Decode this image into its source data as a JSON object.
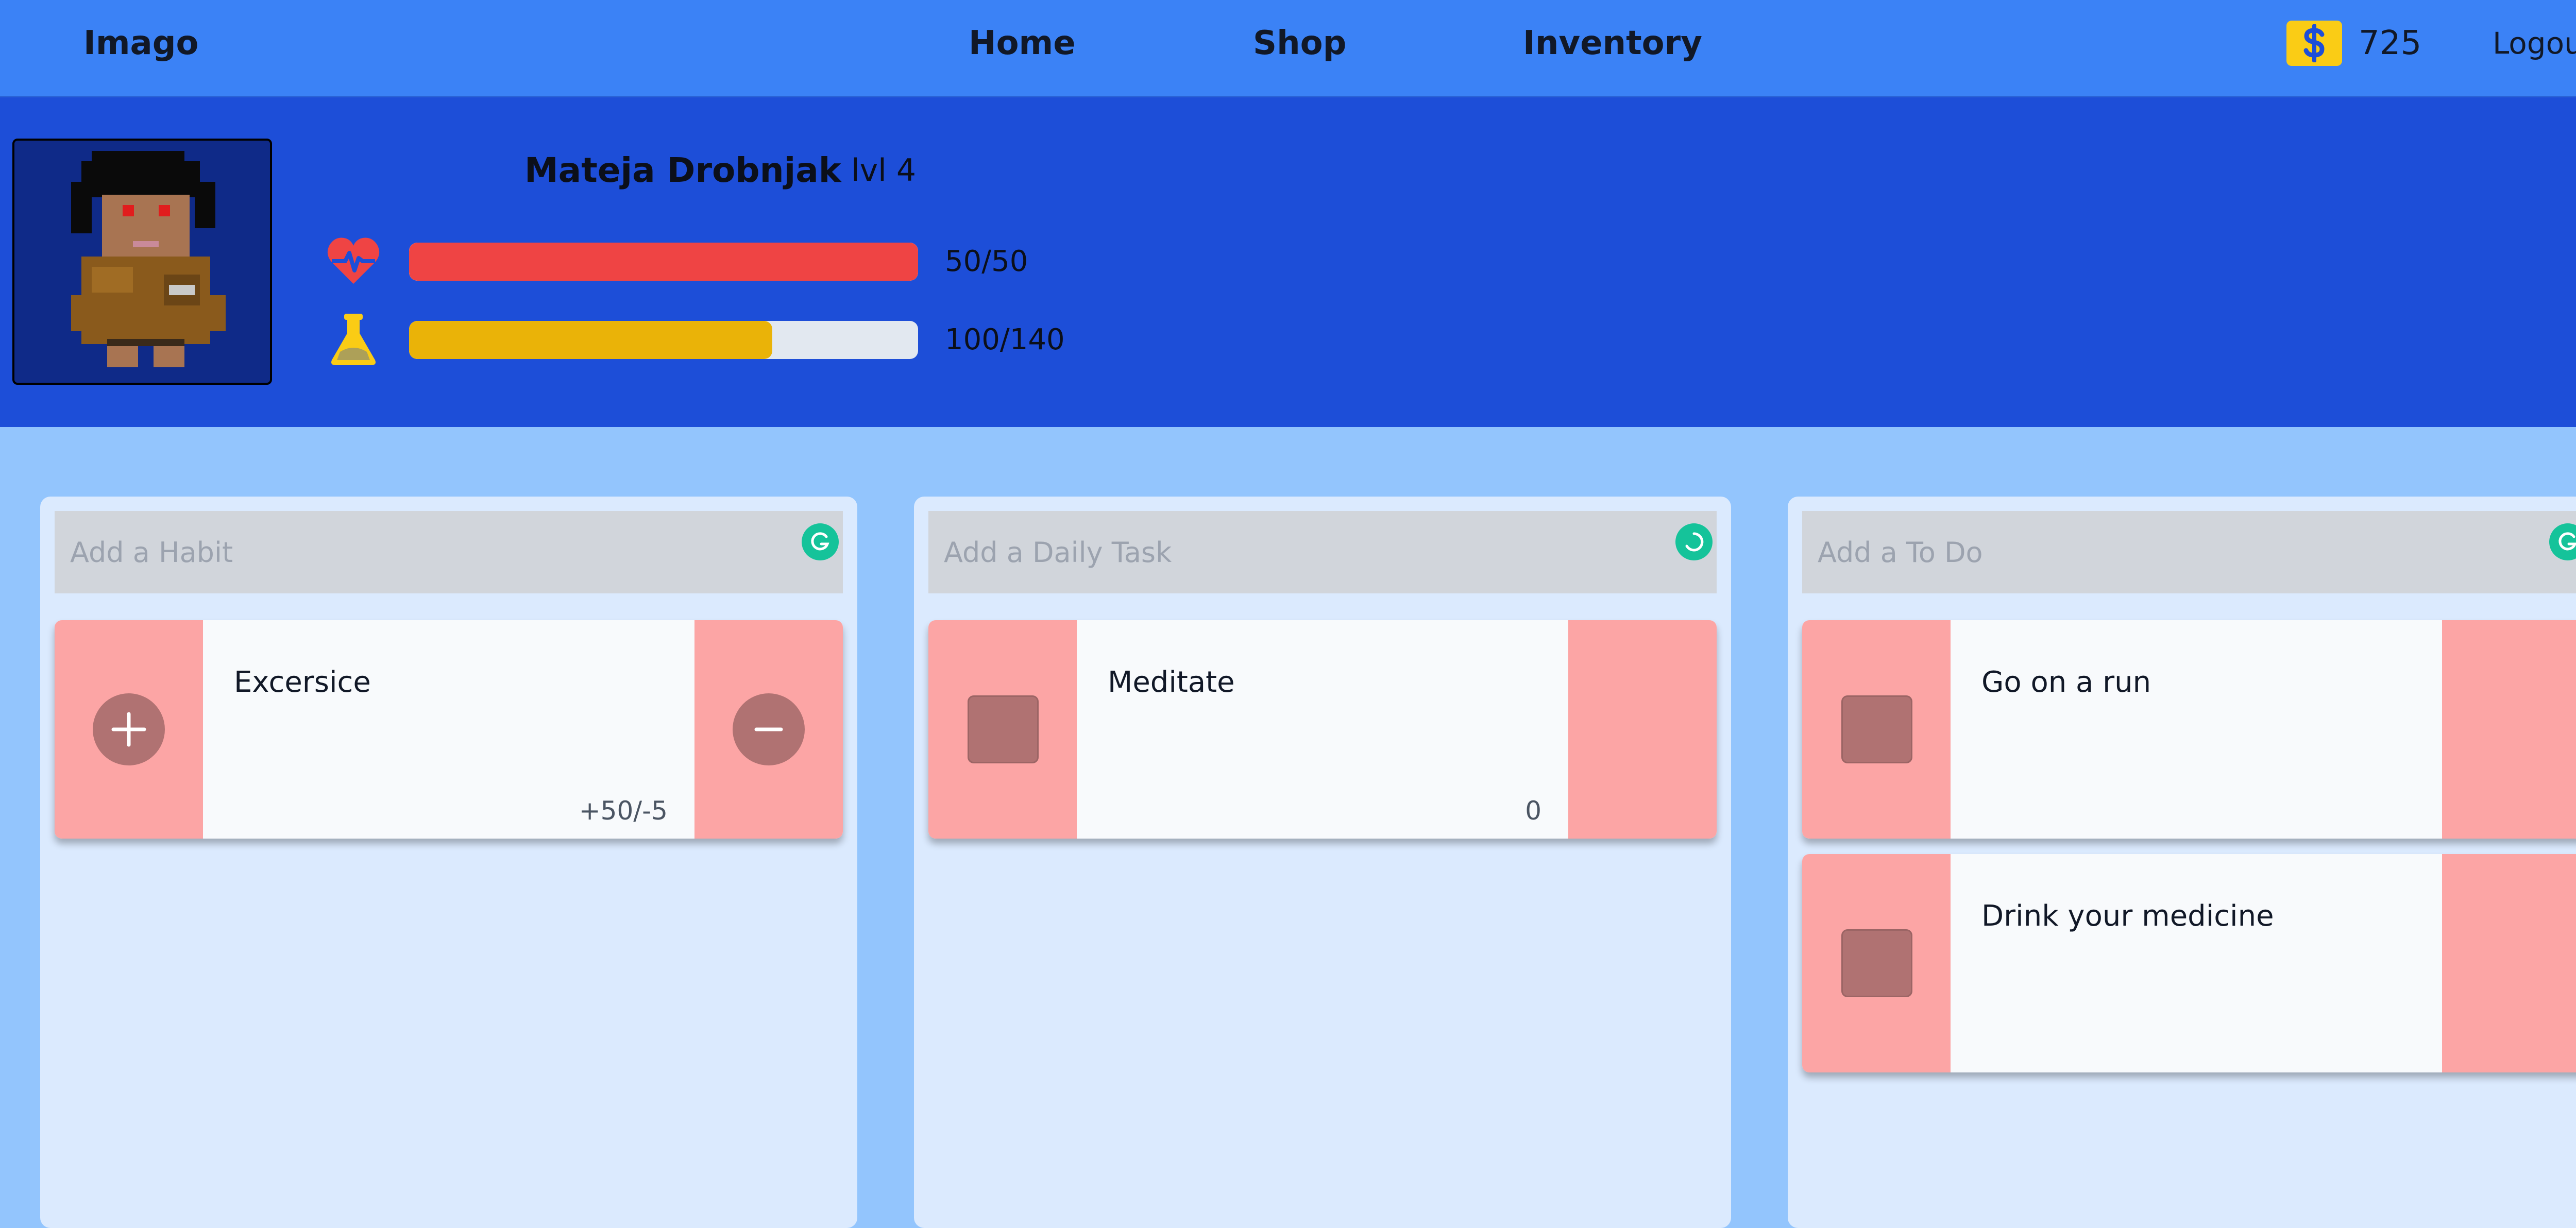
{
  "nav": {
    "brand": "Imago",
    "links": [
      "Home",
      "Shop",
      "Inventory"
    ],
    "coins": "725",
    "coin_icon": "dollar-coin-icon",
    "logout": "Logout"
  },
  "player": {
    "name": "Mateja Drobnjak",
    "level": "lvl 4",
    "health": {
      "text": "50/50",
      "fraction": 1.0,
      "icon": "heart-pulse-icon",
      "color": "#ef4444"
    },
    "experience": {
      "text": "100/140",
      "fraction": 0.714,
      "icon": "flask-icon",
      "color": "#eab308"
    }
  },
  "columns": [
    {
      "placeholder": "Add a Habit",
      "cards": [
        {
          "title": "Excersice",
          "score": "+50/-5"
        }
      ]
    },
    {
      "placeholder": "Add a Daily Task",
      "cards": [
        {
          "title": "Meditate",
          "score": "0"
        }
      ]
    },
    {
      "placeholder": "Add a To Do",
      "cards": [
        {
          "title": "Go on a run"
        },
        {
          "title": "Drink your medicine"
        }
      ]
    }
  ],
  "colors": {
    "navbar": "#3b82f6",
    "header": "#1d4ed8",
    "page": "#93c5fd",
    "column": "#dbeafe",
    "card_side": "#fca5a5"
  }
}
